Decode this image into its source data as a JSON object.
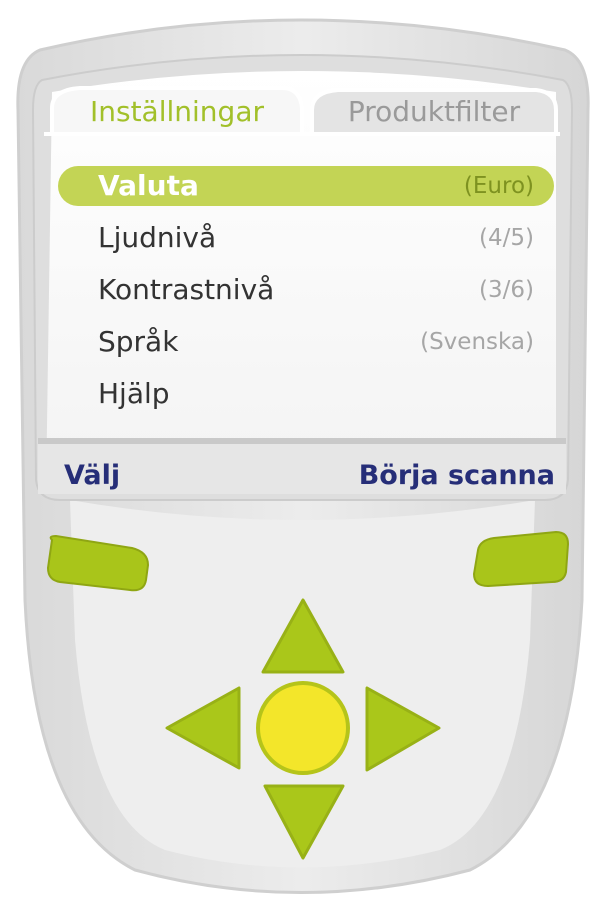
{
  "tabs": [
    {
      "label": "Inställningar",
      "active": true
    },
    {
      "label": "Produktfilter",
      "active": false
    }
  ],
  "menu": {
    "items": [
      {
        "label": "Valuta",
        "value": "(Euro)",
        "selected": true
      },
      {
        "label": "Ljudnivå",
        "value": "(4/5)",
        "selected": false
      },
      {
        "label": "Kontrastnivå",
        "value": "(3/6)",
        "selected": false
      },
      {
        "label": "Språk",
        "value": "(Svenska)",
        "selected": false
      },
      {
        "label": "Hjälp",
        "value": "",
        "selected": false
      }
    ]
  },
  "softkeys": {
    "left_label": "Välj",
    "right_label": "Börja scanna"
  },
  "controls": {
    "left_softkey_icon": "green-pill-button",
    "right_softkey_icon": "green-pill-button",
    "dpad": [
      "arrow-up-icon",
      "arrow-left-icon",
      "arrow-right-icon",
      "arrow-down-icon"
    ],
    "center_button_icon": "yellow-circle-button"
  },
  "colors": {
    "accent_green": "#a9c51a",
    "highlight_green": "#c3d455",
    "center_yellow": "#f3e62a",
    "softkey_text": "#262e78",
    "device_body": "#e6e6e6"
  }
}
